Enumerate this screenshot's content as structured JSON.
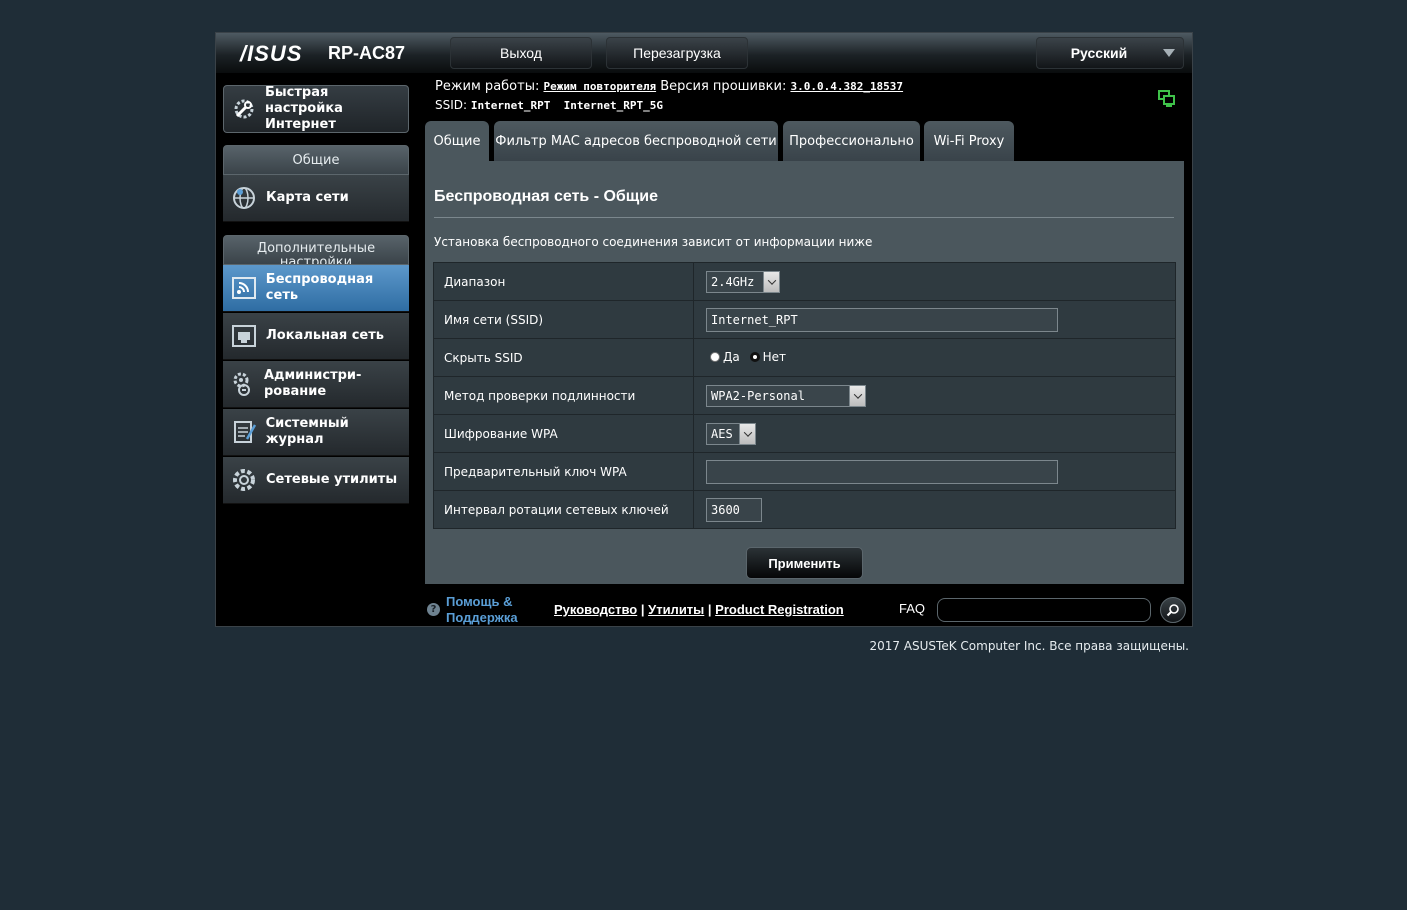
{
  "header": {
    "logo": "/ISUS",
    "model": "RP-AC87",
    "logout_label": "Выход",
    "reboot_label": "Перезагрузка",
    "language": "Русский"
  },
  "sidebar": {
    "quick_setup": "Быстрая настройка Интернет",
    "general_header": "Общие",
    "general_items": [
      {
        "label": "Карта сети",
        "icon": "globe-icon"
      }
    ],
    "advanced_header": "Дополнительные настройки",
    "advanced_items": [
      {
        "label": "Беспроводная сеть",
        "icon": "wireless-icon",
        "active": true
      },
      {
        "label": "Локальная сеть",
        "icon": "lan-icon"
      },
      {
        "label": "Администри-рование",
        "icon": "admin-gear-icon"
      },
      {
        "label": "Системный журнал",
        "icon": "log-icon"
      },
      {
        "label": "Сетевые утилиты",
        "icon": "tools-icon"
      }
    ]
  },
  "status": {
    "mode_label": "Режим работы:",
    "mode_value": "Режим повторителя",
    "firmware_label": "Версия прошивки:",
    "firmware_value": "3.0.0.4.382_18537",
    "ssid_label": "SSID:",
    "ssid_values": "Internet_RPT  Internet_RPT_5G"
  },
  "tabs": [
    "Общие",
    "Фильтр MAC адресов беспроводной сети",
    "Профессионально",
    "Wi-Fi Proxy"
  ],
  "panel": {
    "title": "Беспроводная сеть - Общие",
    "description": "Установка беспроводного соединения зависит от информации ниже",
    "rows": {
      "band_label": "Диапазон",
      "band_value": "2.4GHz",
      "ssid_label": "Имя сети (SSID)",
      "ssid_value": "Internet_RPT",
      "hide_label": "Скрыть SSID",
      "hide_yes": "Да",
      "hide_no": "Нет",
      "auth_label": "Метод проверки подлинности",
      "auth_value": "WPA2-Personal",
      "enc_label": "Шифрование WPA",
      "enc_value": "AES",
      "psk_label": "Предварительный ключ WPA",
      "psk_value": "",
      "rekey_label": "Интервал ротации сетевых ключей",
      "rekey_value": "3600"
    },
    "apply_label": "Применить"
  },
  "footer": {
    "help": "Помощь & Поддержка",
    "manual": "Руководство",
    "utilities": "Утилиты",
    "registration": "Product Registration",
    "faq": "FAQ",
    "copyright": "2017 ASUSTeK Computer Inc. Все права защищены."
  }
}
